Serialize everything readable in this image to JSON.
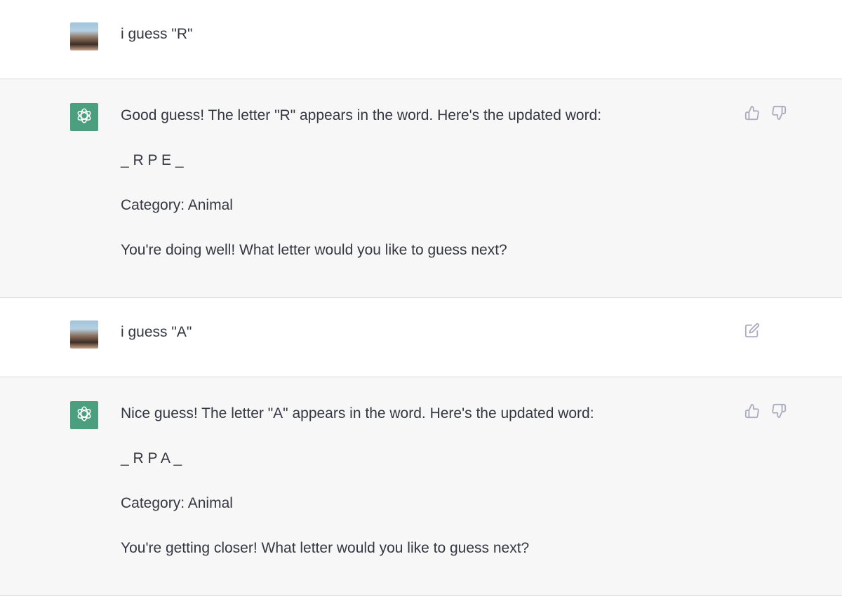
{
  "messages": [
    {
      "role": "user",
      "text": "i guess \"R\""
    },
    {
      "role": "assistant",
      "paragraphs": [
        "Good guess! The letter \"R\" appears in the word. Here's the updated word:",
        "_ R P E _",
        "Category: Animal",
        "You're doing well! What letter would you like to guess next?"
      ]
    },
    {
      "role": "user",
      "text": "i guess \"A\""
    },
    {
      "role": "assistant",
      "paragraphs": [
        "Nice guess! The letter \"A\" appears in the word. Here's the updated word:",
        "_ R P A _",
        "Category: Animal",
        "You're getting closer! What letter would you like to guess next?"
      ]
    }
  ],
  "icons": {
    "thumbs_up": "thumbs-up-icon",
    "thumbs_down": "thumbs-down-icon",
    "edit": "edit-icon",
    "bot_logo": "openai-logo-icon"
  },
  "colors": {
    "assistant_bg": "#f7f7f8",
    "bot_avatar": "#4b9f7f",
    "text": "#353740",
    "icon": "#acacbe"
  }
}
